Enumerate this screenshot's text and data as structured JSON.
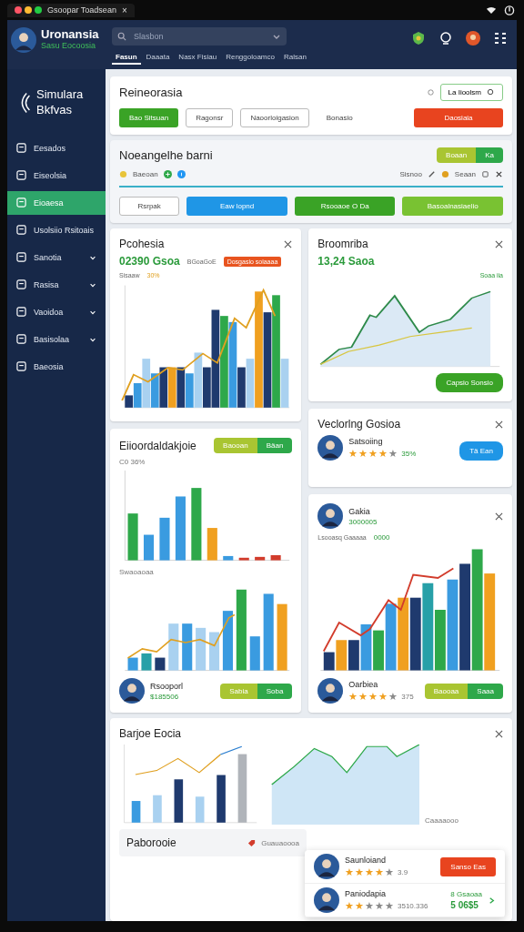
{
  "titlebar": {
    "title": "Gsoopar Toadsean",
    "close": "×"
  },
  "header": {
    "user_name": "Uronansia",
    "user_subtitle": "Sasu Eocoosia",
    "search_placeholder": "Slasbon",
    "tabs": [
      {
        "label": "Fasun",
        "selected": true
      },
      {
        "label": "Daaata",
        "selected": false
      },
      {
        "label": "Nasx Fisiau",
        "selected": false
      },
      {
        "label": "Renggoloamco",
        "selected": false
      },
      {
        "label": "Ralsan",
        "selected": false
      }
    ]
  },
  "sidebar": {
    "brand": "Simulara Bkfvas",
    "items": [
      {
        "label": "Eesados",
        "selected": false,
        "expandable": false
      },
      {
        "label": "Eiseolsia",
        "selected": false,
        "expandable": false
      },
      {
        "label": "Eioaesa",
        "selected": true,
        "expandable": false
      },
      {
        "label": "Usolsiio Rsitoais",
        "selected": false,
        "expandable": false
      },
      {
        "label": "Sanotia",
        "selected": false,
        "expandable": true
      },
      {
        "label": "Rasisa",
        "selected": false,
        "expandable": true
      },
      {
        "label": "Vaoidoa",
        "selected": false,
        "expandable": true
      },
      {
        "label": "Basisolaa",
        "selected": false,
        "expandable": true
      },
      {
        "label": "Baeosia",
        "selected": false,
        "expandable": false
      }
    ]
  },
  "toolbar_panel": {
    "title": "Reineorasia",
    "action": "La Iioolsm",
    "buttons": [
      {
        "label": "Bao Sitsuan",
        "kind": "primary"
      },
      {
        "label": "Ragonsr",
        "kind": "outline"
      },
      {
        "label": "Naoorloigasion",
        "kind": "outline"
      },
      {
        "label": "Bonasio",
        "kind": "text"
      },
      {
        "label": "Daosiaia",
        "kind": "danger"
      }
    ]
  },
  "flow_panel": {
    "title": "Noeangelhe barni",
    "toggle": [
      {
        "label": "Boaan",
        "selected": false
      },
      {
        "label": "Ka",
        "selected": true
      }
    ],
    "left_label": "Baeoan",
    "mid_label": "Sisnoo",
    "right_label": "Seaan",
    "buttons": [
      {
        "label": "Rsrpak",
        "kind": "outline"
      },
      {
        "label": "Eaw lopnd",
        "kind": "blue"
      },
      {
        "label": "Rsooaoe O Da",
        "kind": "primary"
      },
      {
        "label": "Basoalnasiaelio",
        "kind": "lime"
      }
    ]
  },
  "revenue_card": {
    "title": "Pcohesia",
    "value": "02390 Gsoa",
    "legend_1": "BGoaGoE",
    "badge": "Dosgasio soiaaaa",
    "legend_2": "Sisaaw",
    "legend_3": "30%"
  },
  "growth_card": {
    "title": "Broomriba",
    "value": "13,24 Saoa",
    "legend": "Soaa iia",
    "button": "Capsio Sonsio"
  },
  "rating_card": {
    "title": "Veclorlng Gosioa",
    "name": "Satsoiing",
    "stars": 4,
    "score": "35%",
    "button": "Tä Ean"
  },
  "compare_card": {
    "title": "Eiioordaldakjoie",
    "toggle": [
      {
        "label": "Baooan",
        "selected": false
      },
      {
        "label": "Bäan",
        "selected": true
      }
    ],
    "value": "C0 36%",
    "sub_label": "Swaoaoaa",
    "person": {
      "name": "Rsooporl",
      "amount": "$185506"
    },
    "actions": [
      {
        "label": "Sabia",
        "selected": false
      },
      {
        "label": "Soba",
        "selected": true
      }
    ]
  },
  "profile_card": {
    "title": "Gakia",
    "amount": "3000005",
    "chart_label": "Lsooasq Gaaaaa",
    "chart_value": "0000",
    "person": {
      "name": "Oarbiea",
      "stars": 4,
      "score": "375"
    },
    "actions": [
      {
        "label": "Baooaa",
        "selected": false
      },
      {
        "label": "Saaa",
        "selected": true
      }
    ]
  },
  "trend_card": {
    "title": "Barjoe Eocia",
    "note": "Caaaaooo"
  },
  "footer_card": {
    "title": "Paborooie",
    "link": "Guauaoooa"
  },
  "overlay_card": {
    "rows": [
      {
        "name": "Saunloiand",
        "stars": 4,
        "score": "3.9",
        "button": "Sanso Eas"
      },
      {
        "name": "Paniodapia",
        "stars": 2,
        "score": "3510.336",
        "badge_label": "8 Gsaoaa",
        "amount": "5 06$5"
      }
    ]
  }
}
